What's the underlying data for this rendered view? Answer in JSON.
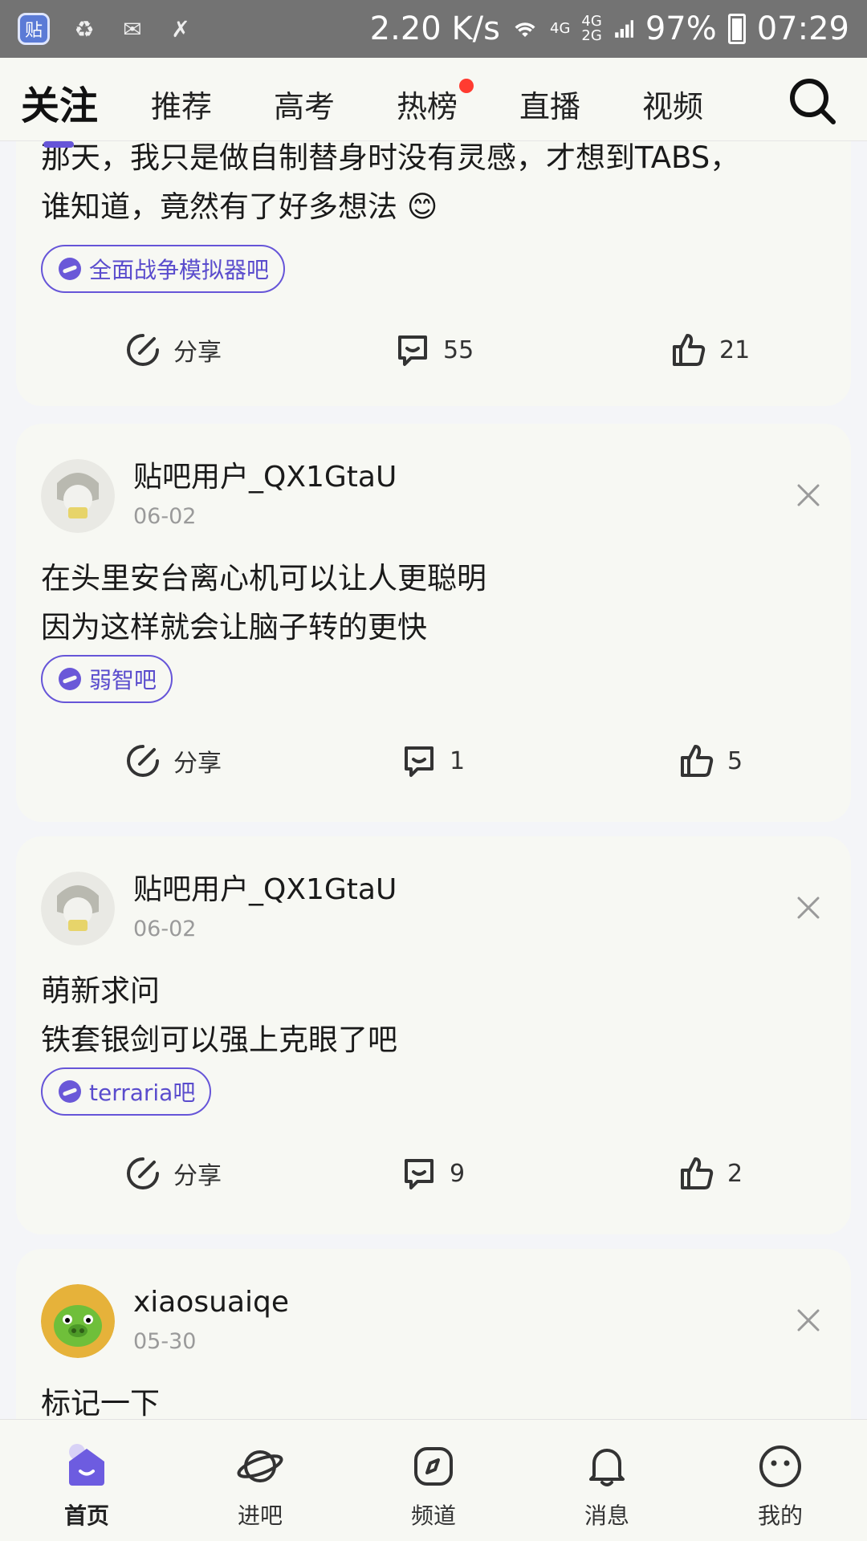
{
  "status_bar": {
    "app_icon_text": "贴",
    "speed": "2.20 K/s",
    "net_a": "4G",
    "net_b1": "4G",
    "net_b2": "2G",
    "battery": "97%",
    "time": "07:29"
  },
  "tabs": [
    {
      "label": "关注"
    },
    {
      "label": "推荐"
    },
    {
      "label": "高考"
    },
    {
      "label": "热榜"
    },
    {
      "label": "直播"
    },
    {
      "label": "视频"
    }
  ],
  "posts": [
    {
      "text_lines": [
        "那天，我只是做自制替身时没有灵感，才想到TABS，",
        "谁知道，竟然有了好多想法 😊"
      ],
      "tag": "全面战争模拟器吧",
      "share_label": "分享",
      "comments": "55",
      "likes": "21"
    },
    {
      "user": "贴吧用户_QX1GtaU",
      "date": "06-02",
      "text_lines": [
        "在头里安台离心机可以让人更聪明",
        "因为这样就会让脑子转的更快"
      ],
      "tag": "弱智吧",
      "share_label": "分享",
      "comments": "1",
      "likes": "5"
    },
    {
      "user": "贴吧用户_QX1GtaU",
      "date": "06-02",
      "text_lines": [
        "萌新求问",
        "铁套银剑可以强上克眼了吧"
      ],
      "tag": "terraria吧",
      "share_label": "分享",
      "comments": "9",
      "likes": "2"
    },
    {
      "user": "xiaosuaiqe",
      "date": "05-30",
      "text_lines": [
        "标记一下"
      ]
    }
  ],
  "bottom_nav": [
    {
      "label": "首页",
      "icon": "home-icon"
    },
    {
      "label": "进吧",
      "icon": "planet-icon"
    },
    {
      "label": "频道",
      "icon": "compass-icon"
    },
    {
      "label": "消息",
      "icon": "bell-icon"
    },
    {
      "label": "我的",
      "icon": "smile-icon"
    }
  ],
  "colors": {
    "accent": "#6655d8",
    "badge_red": "#ff3b30",
    "status_bar": "#737373"
  }
}
